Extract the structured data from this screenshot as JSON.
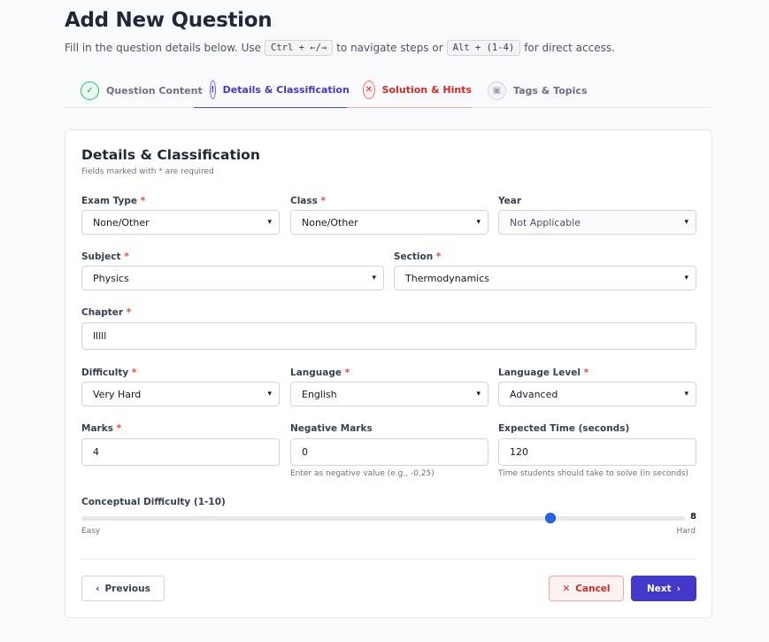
{
  "header": {
    "title": "Add New Question",
    "subtitle_pre": "Fill in the question details below. Use",
    "shortcut_nav": "Ctrl + ←/→",
    "subtitle_mid": "to navigate steps or",
    "shortcut_direct": "Alt + (1-4)",
    "subtitle_post": "for direct access."
  },
  "tabs": [
    {
      "label": "Question Content",
      "state": "completed",
      "icon": "check-circle-icon"
    },
    {
      "label": "Details & Classification",
      "state": "active",
      "icon": "info-circle-icon"
    },
    {
      "label": "Solution & Hints",
      "state": "error",
      "icon": "x-circle-icon"
    },
    {
      "label": "Tags & Topics",
      "state": "pending",
      "icon": "save-icon"
    }
  ],
  "card": {
    "title": "Details & Classification",
    "required_note_pre": "Fields marked with",
    "required_star": "*",
    "required_note_post": "are required"
  },
  "fields": {
    "exam_type": {
      "label": "Exam Type",
      "value": "None/Other"
    },
    "class": {
      "label": "Class",
      "value": "None/Other"
    },
    "year": {
      "label": "Year",
      "value": "Not Applicable"
    },
    "subject": {
      "label": "Subject",
      "value": "Physics"
    },
    "section": {
      "label": "Section",
      "value": "Thermodynamics"
    },
    "chapter": {
      "label": "Chapter",
      "value": "lllll"
    },
    "difficulty": {
      "label": "Difficulty",
      "value": "Very Hard"
    },
    "language": {
      "label": "Language",
      "value": "English"
    },
    "language_level": {
      "label": "Language Level",
      "value": "Advanced"
    },
    "marks": {
      "label": "Marks",
      "value": "4"
    },
    "negative_marks": {
      "label": "Negative Marks",
      "value": "0",
      "help": "Enter as negative value (e.g., -0.25)"
    },
    "expected_time": {
      "label": "Expected Time (seconds)",
      "value": "120",
      "help": "Time students should take to solve (in seconds)"
    }
  },
  "slider": {
    "label": "Conceptual Difficulty (1-10)",
    "value": 8,
    "value_text": "8",
    "min": 1,
    "max": 10,
    "min_label": "Easy",
    "max_label": "Hard"
  },
  "actions": {
    "previous": "Previous",
    "cancel": "Cancel",
    "next": "Next"
  },
  "colors": {
    "primary": "#4338ca",
    "success": "#22c55e",
    "danger": "#dc2626",
    "slider_thumb": "#2563eb"
  }
}
